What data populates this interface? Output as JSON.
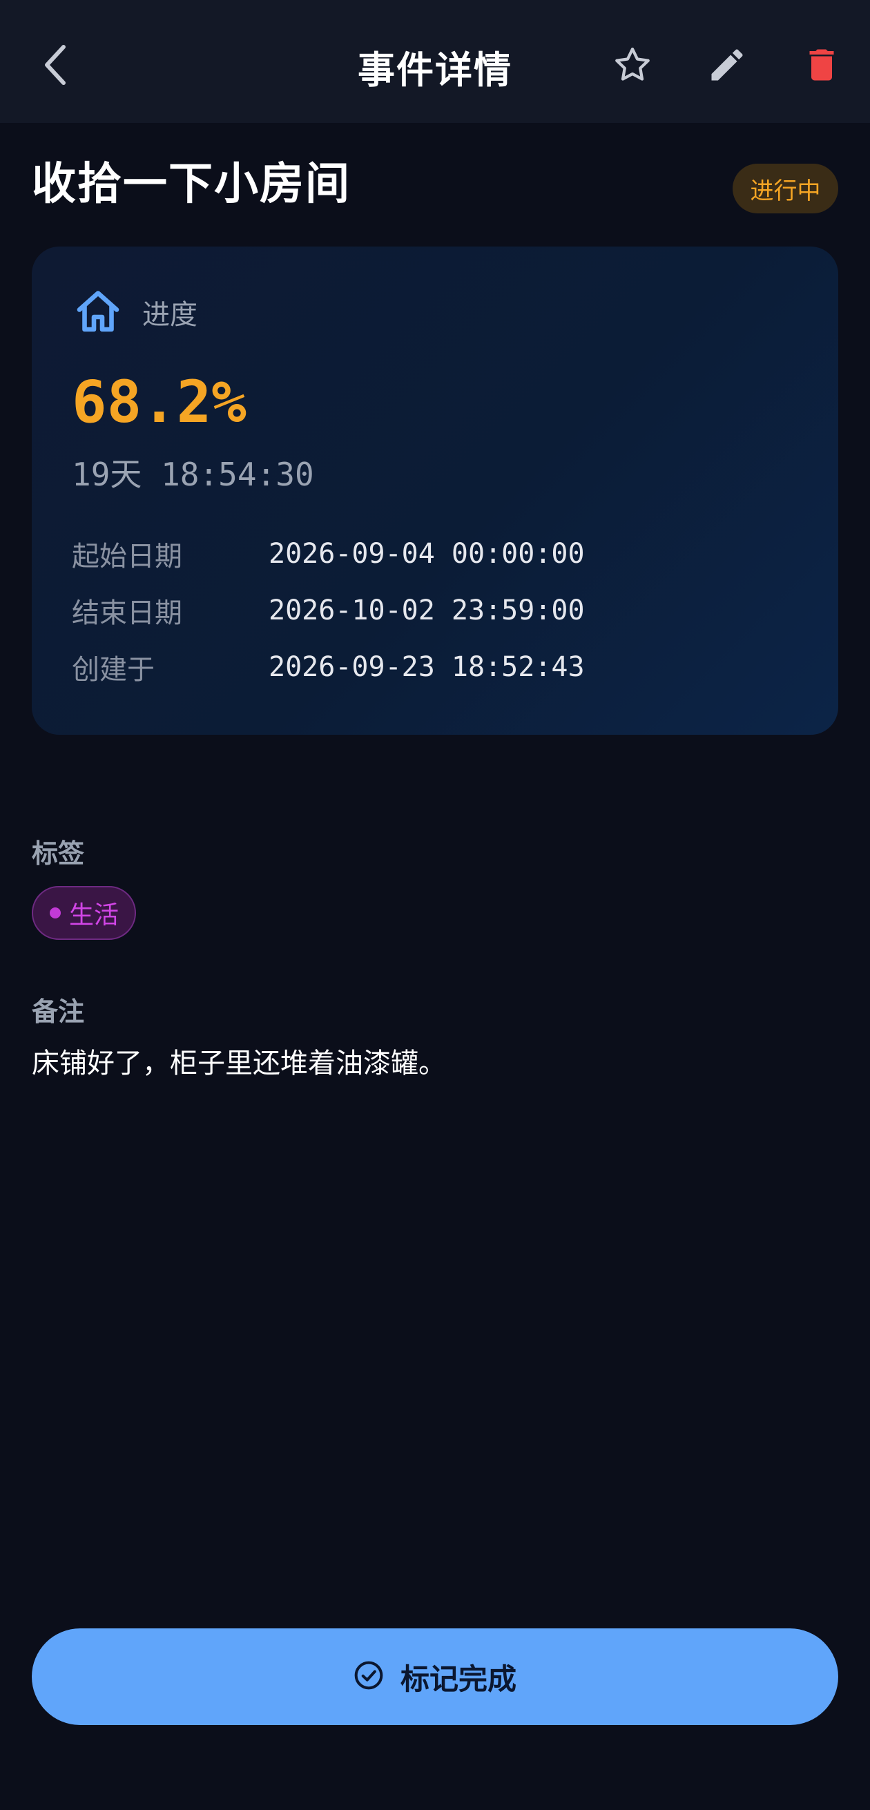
{
  "header": {
    "title": "事件详情",
    "icons": {
      "back": "back-chevron-icon",
      "favorite": "star-outline-icon",
      "edit": "pencil-icon",
      "delete": "trash-icon"
    }
  },
  "event": {
    "title": "收拾一下小房间",
    "status": "进行中"
  },
  "progress_card": {
    "icon": "home-icon",
    "label": "进度",
    "percent": "68.2%",
    "remaining": "19天 18:54:30",
    "rows": [
      {
        "key": "起始日期",
        "value": "2026-09-04 00:00:00"
      },
      {
        "key": "结束日期",
        "value": "2026-10-02 23:59:00"
      },
      {
        "key": "创建于",
        "value": "2026-09-23 18:52:43"
      }
    ]
  },
  "tags": {
    "label": "标签",
    "items": [
      {
        "name": "生活",
        "color": "#d145e6"
      }
    ]
  },
  "notes": {
    "label": "备注",
    "text": "床铺好了，柜子里还堆着油漆罐。"
  },
  "actions": {
    "complete_label": "标记完成",
    "complete_icon": "check-circle-icon"
  },
  "colors": {
    "background": "#0b0e1a",
    "appbar": "#131826",
    "accent_orange": "#f5a524",
    "primary_blue": "#60a5fa",
    "danger_red": "#ef4444",
    "tag_purple": "#d145e6"
  }
}
